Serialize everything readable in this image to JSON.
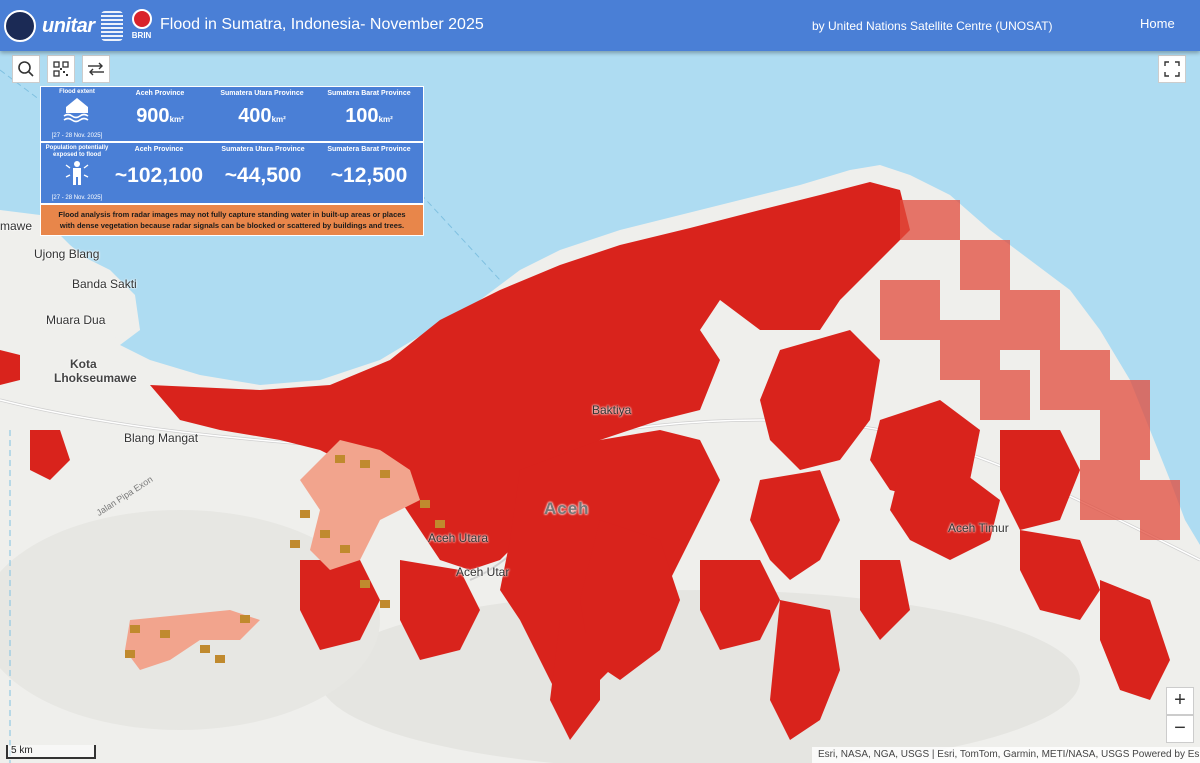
{
  "header": {
    "title": "Flood in Sumatra, Indonesia- November 2025",
    "credit": "by United Nations Satellite Centre (UNOSAT)",
    "home_label": "Home",
    "logos": {
      "unitar": "unitar",
      "brin": "BRIN"
    }
  },
  "toolbar": {
    "search_icon": "search-icon",
    "qr_icon": "qr-code-icon",
    "swipe_icon": "swipe-icon",
    "fullscreen_icon": "fullscreen-icon"
  },
  "panel": {
    "flood_extent": {
      "label": "Flood extent",
      "date": "[27 - 28  Nov. 2025]",
      "unit": "km²",
      "cells": [
        {
          "province": "Aceh Province",
          "value": "900"
        },
        {
          "province": "Sumatera Utara Province",
          "value": "400"
        },
        {
          "province": "Sumatera Barat Province",
          "value": "100"
        }
      ]
    },
    "population": {
      "label": "Population potentially exposed to flood",
      "date": "[27 - 28 Nov. 2025]",
      "cells": [
        {
          "province": "Aceh Province",
          "value": "~102,100"
        },
        {
          "province": "Sumatera Utara Province",
          "value": "~44,500"
        },
        {
          "province": "Sumatera Barat Province",
          "value": "~12,500"
        }
      ]
    },
    "note": "Flood analysis from radar images may not fully capture standing water in built-up areas or places with dense vegetation because radar signals can be blocked or scattered by buildings and trees."
  },
  "map": {
    "places": {
      "mawe": "mawe",
      "ujong_blang": "Ujong Blang",
      "banda_sakti": "Banda Sakti",
      "muara_dua": "Muara Dua",
      "kota": "Kota",
      "lhokseumawe": "Lhokseumawe",
      "blang_mangat": "Blang Mangat",
      "baktiya": "Baktiya",
      "aceh_region": "Aceh",
      "aceh_utara": "Aceh Utara",
      "aceh_utara_2": "Aceh Utar",
      "aceh_timur": "Aceh Timur",
      "jalan": "Jalan Pipa Exon"
    },
    "colors": {
      "sea": "#aedcf2",
      "land": "#efefec",
      "flood": "#d9231c",
      "flood_light": "#f2a48d",
      "flood_edge": "#c08a2e"
    },
    "zoom_in": "+",
    "zoom_out": "−",
    "scale_label": "5 km",
    "attribution": "Esri, NASA, NGA, USGS | Esri, TomTom, Garmin, METI/NASA, USGS    Powered by Esri"
  }
}
